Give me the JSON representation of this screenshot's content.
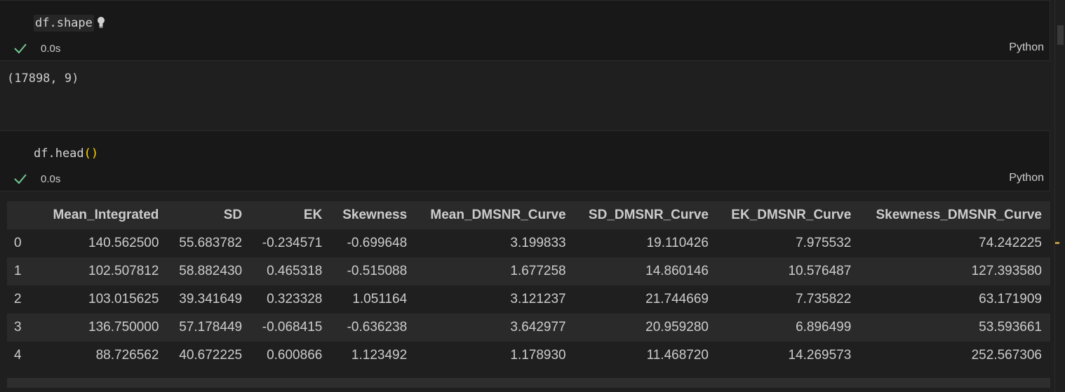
{
  "cells": [
    {
      "code": "df.shape",
      "status_time": "0.0s",
      "language": "Python",
      "output": "(17898, 9)"
    },
    {
      "code_name": "df.head",
      "code_parens": "()",
      "status_time": "0.0s",
      "language": "Python"
    }
  ],
  "table": {
    "columns": [
      "",
      "Mean_Integrated",
      "SD",
      "EK",
      "Skewness",
      "Mean_DMSNR_Curve",
      "SD_DMSNR_Curve",
      "EK_DMSNR_Curve",
      "Skewness_DMSNR_Curve"
    ],
    "rows": [
      [
        "0",
        "140.562500",
        "55.683782",
        "-0.234571",
        "-0.699648",
        "3.199833",
        "19.110426",
        "7.975532",
        "74.242225"
      ],
      [
        "1",
        "102.507812",
        "58.882430",
        "0.465318",
        "-0.515088",
        "1.677258",
        "14.860146",
        "10.576487",
        "127.393580"
      ],
      [
        "2",
        "103.015625",
        "39.341649",
        "0.323328",
        "1.051164",
        "3.121237",
        "21.744669",
        "7.735822",
        "63.171909"
      ],
      [
        "3",
        "136.750000",
        "57.178449",
        "-0.068415",
        "-0.636238",
        "3.642977",
        "20.959280",
        "6.896499",
        "53.593661"
      ],
      [
        "4",
        "88.726562",
        "40.672225",
        "0.600866",
        "1.123492",
        "1.178930",
        "11.468720",
        "14.269573",
        "252.567306"
      ]
    ]
  },
  "colors": {
    "background": "#1f1f1f",
    "cell_background": "#181818",
    "check_green": "#73c991",
    "paren_yellow": "#ffd700"
  },
  "icons": {
    "status": "check-icon",
    "hint": "lightbulb-icon"
  }
}
